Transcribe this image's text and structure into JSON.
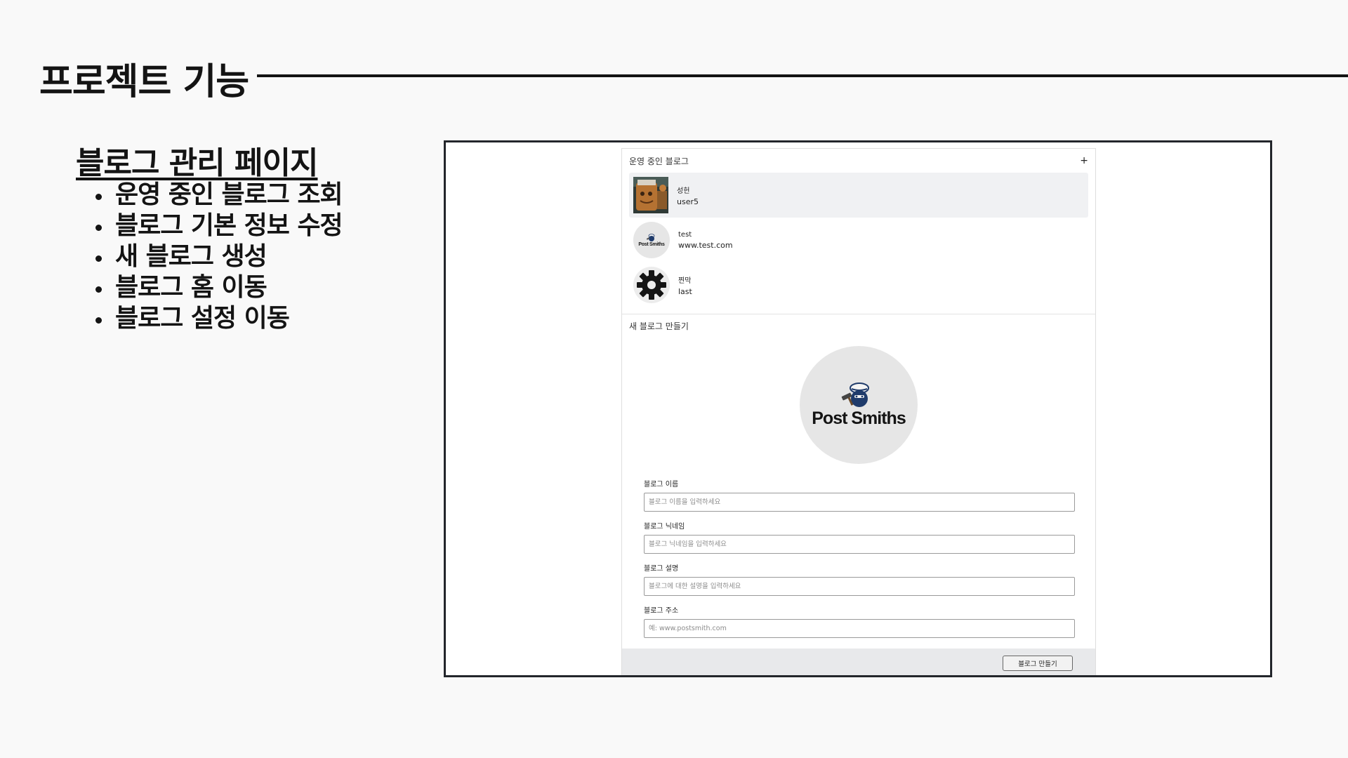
{
  "slide": {
    "title": "프로젝트 기능",
    "section_heading": "블로그 관리 페이지",
    "bullets": [
      "운영 중인 블로그 조회",
      "블로그 기본 정보 수정",
      "새 블로그 생성",
      "블로그 홈 이동",
      "블로그 설정 이동"
    ]
  },
  "app": {
    "blog_list": {
      "title": "운영 중인 블로그",
      "add_label": "+",
      "items": [
        {
          "name": "성헌",
          "sub": "user5",
          "avatar": "profile-photo",
          "selected": true
        },
        {
          "name": "test",
          "sub": "www.test.com",
          "avatar": "postsmiths-logo",
          "selected": false
        },
        {
          "name": "찐막",
          "sub": "last",
          "avatar": "gear-icon",
          "selected": false
        }
      ]
    },
    "logo_text": "Post Smiths",
    "new_blog": {
      "title": "새 블로그 만들기",
      "fields": [
        {
          "label": "블로그 이름",
          "placeholder": "블로그 이름을 입력하세요",
          "value": ""
        },
        {
          "label": "블로그 닉네임",
          "placeholder": "블로그 닉네임을 입력하세요",
          "value": ""
        },
        {
          "label": "블로그 설명",
          "placeholder": "블로그에 대한 설명을 입력하세요",
          "value": ""
        },
        {
          "label": "블로그 주소",
          "placeholder": "예: www.postsmith.com",
          "value": ""
        }
      ],
      "submit_label": "블로그 만들기"
    }
  },
  "colors": {
    "background": "#f9f9f9",
    "text": "#141414",
    "frame_border": "#23262b",
    "selected_row": "#f0f1f3",
    "footer": "#e8e9eb",
    "logo_navy": "#1f3b6b"
  }
}
